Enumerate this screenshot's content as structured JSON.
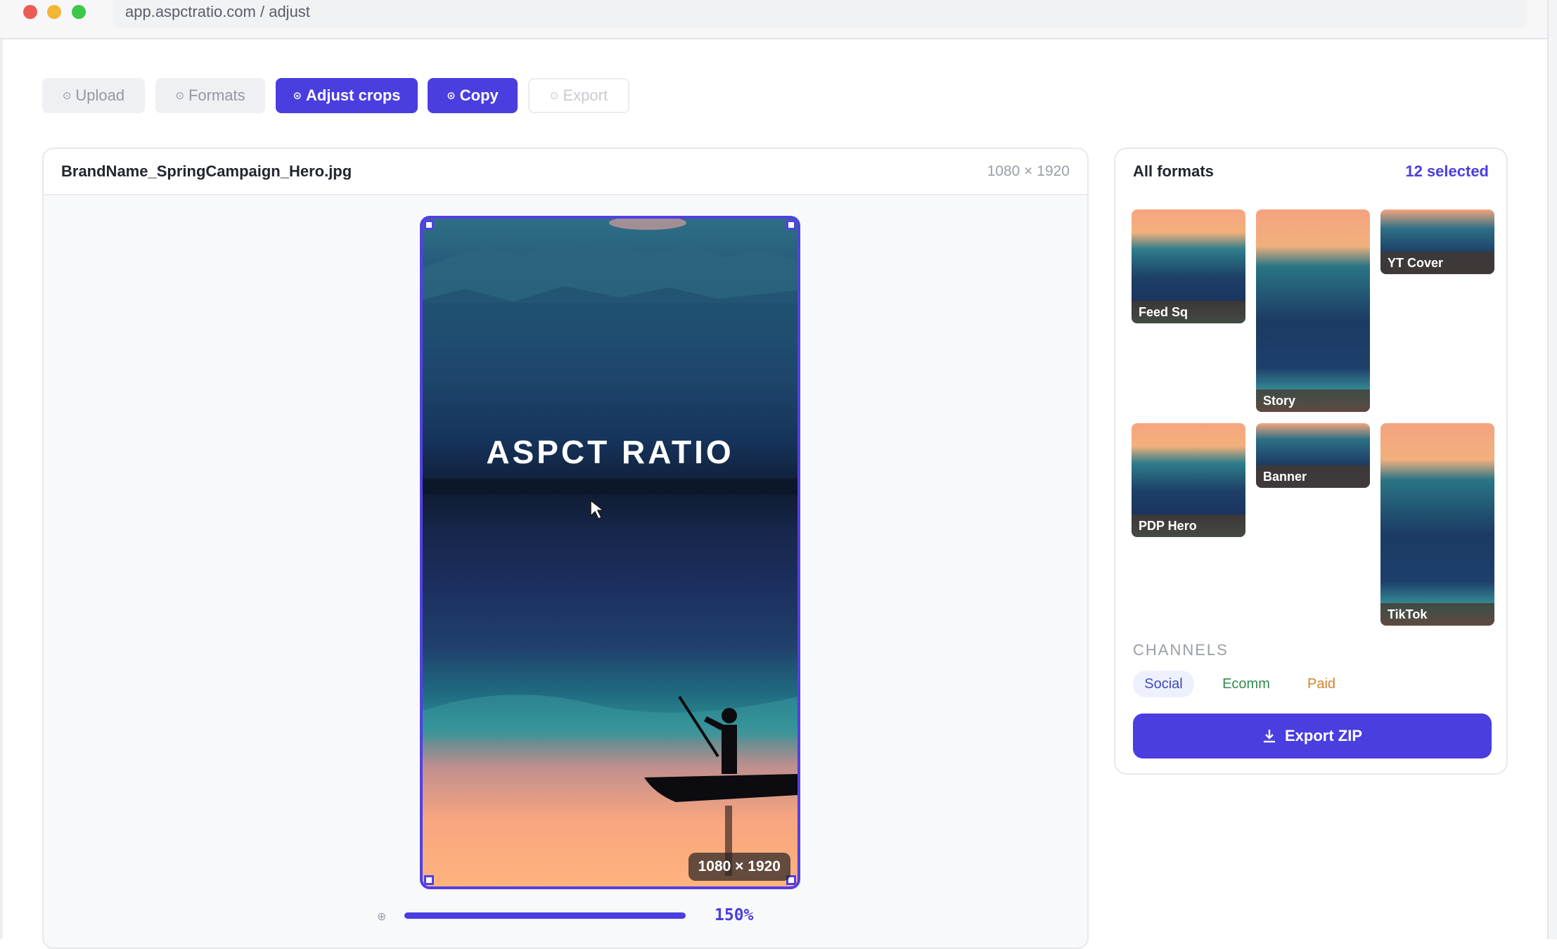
{
  "browser": {
    "url": "app.aspctratio.com / adjust"
  },
  "steps": {
    "upload": "Upload",
    "formats": "Formats",
    "adjust": "Adjust crops",
    "copy": "Copy",
    "export": "Export"
  },
  "editor": {
    "filename": "BrandName_SpringCampaign_Hero.jpg",
    "dimensions": "1080 × 1920",
    "crop_title": "ASPCT RATIO",
    "crop_dims": "1080 × 1920",
    "zoom_label": "150%",
    "zoom_fill_fraction": 1.0
  },
  "formats": {
    "title": "All formats",
    "selected": "12 selected",
    "thumbnails": [
      "Feed Sq",
      "Story",
      "YT Cover",
      "PDP Hero",
      "Banner",
      "TikTok"
    ],
    "channels_heading": "CHANNELS",
    "channels": [
      "Social",
      "Ecomm",
      "Paid"
    ],
    "export_label": "Export ZIP"
  },
  "colors": {
    "accent": "#4a3ee0",
    "social": "#3f4bbf",
    "ecomm": "#2f8a4a",
    "paid": "#d9822b"
  },
  "icons": {
    "step": "circle-dot-icon",
    "cursor": "mouse-cursor-icon",
    "zoom": "zoom-icon",
    "export": "download-icon",
    "boatman": "boatman-silhouette-icon"
  }
}
